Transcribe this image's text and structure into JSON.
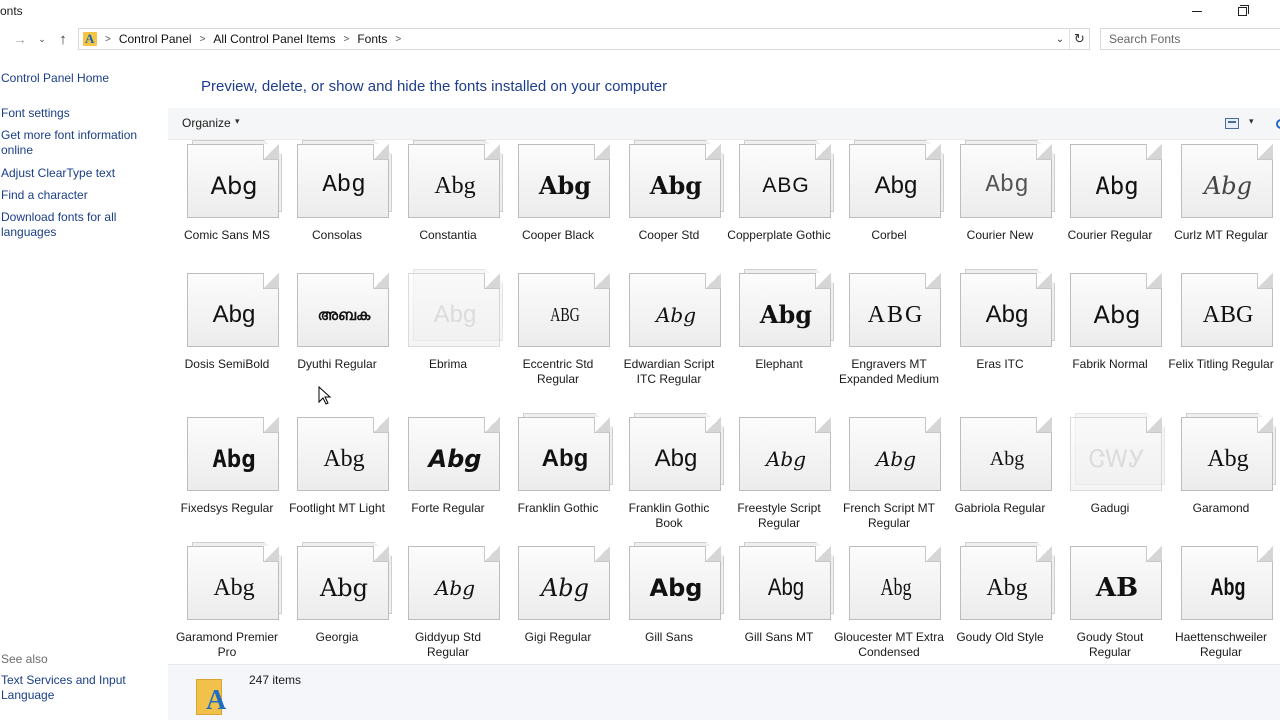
{
  "window": {
    "title": "onts"
  },
  "nav": {
    "back_glyph": "←",
    "forward_glyph": "→",
    "recent_glyph": "⌄",
    "up_glyph": "↑"
  },
  "address": {
    "breadcrumbs": [
      "Control Panel",
      "All Control Panel Items",
      "Fonts"
    ],
    "separator": ">",
    "dropdown_glyph": "⌄",
    "refresh_glyph": "↻"
  },
  "search": {
    "placeholder": "Search Fonts",
    "value": ""
  },
  "sidebar": {
    "links": [
      {
        "label": "Control Panel Home"
      },
      {
        "label": "Font settings"
      },
      {
        "label": "Get more font information online"
      },
      {
        "label": "Adjust ClearType text"
      },
      {
        "label": "Find a character"
      },
      {
        "label": "Download fonts for all languages"
      }
    ],
    "see_also_heading": "See also",
    "see_also_links": [
      {
        "label": "Text Services and Input Language"
      }
    ]
  },
  "main": {
    "heading": "Preview, delete, or show and hide the fonts installed on your computer",
    "toolbar": {
      "organize_label": "Organize",
      "caret": "▾"
    }
  },
  "fonts": [
    {
      "name": "Comic Sans MS",
      "sample": "Abg",
      "stacked": true
    },
    {
      "name": "Consolas",
      "sample": "Abg",
      "stacked": true
    },
    {
      "name": "Constantia",
      "sample": "Abg",
      "stacked": true
    },
    {
      "name": "Cooper Black",
      "sample": "Abg",
      "stacked": false
    },
    {
      "name": "Cooper Std",
      "sample": "Abg",
      "stacked": true
    },
    {
      "name": "Copperplate Gothic",
      "sample": "ABG",
      "stacked": true
    },
    {
      "name": "Corbel",
      "sample": "Abg",
      "stacked": true
    },
    {
      "name": "Courier New",
      "sample": "Abg",
      "stacked": true
    },
    {
      "name": "Courier Regular",
      "sample": "Abg",
      "stacked": false
    },
    {
      "name": "Curlz MT Regular",
      "sample": "Abg",
      "stacked": false
    },
    {
      "name": "Dosis SemiBold",
      "sample": "Abg",
      "stacked": false
    },
    {
      "name": "Dyuthi Regular",
      "sample": "അബക",
      "stacked": false
    },
    {
      "name": "Ebrima",
      "sample": "Abg",
      "stacked": true,
      "faded": true
    },
    {
      "name": "Eccentric Std Regular",
      "sample": "ABG",
      "stacked": false
    },
    {
      "name": "Edwardian Script ITC Regular",
      "sample": "Abg",
      "stacked": false
    },
    {
      "name": "Elephant",
      "sample": "Abg",
      "stacked": true
    },
    {
      "name": "Engravers MT Expanded Medium",
      "sample": "ABG",
      "stacked": false
    },
    {
      "name": "Eras ITC",
      "sample": "Abg",
      "stacked": true
    },
    {
      "name": "Fabrik Normal",
      "sample": "Abg",
      "stacked": false
    },
    {
      "name": "Felix Titling Regular",
      "sample": "ABG",
      "stacked": false
    },
    {
      "name": "Fixedsys Regular",
      "sample": "Abg",
      "stacked": false
    },
    {
      "name": "Footlight MT Light",
      "sample": "Abg",
      "stacked": false
    },
    {
      "name": "Forte Regular",
      "sample": "Abg",
      "stacked": false
    },
    {
      "name": "Franklin Gothic",
      "sample": "Abg",
      "stacked": true
    },
    {
      "name": "Franklin Gothic Book",
      "sample": "Abg",
      "stacked": true
    },
    {
      "name": "Freestyle Script Regular",
      "sample": "Abg",
      "stacked": false
    },
    {
      "name": "French Script MT Regular",
      "sample": "Abg",
      "stacked": false
    },
    {
      "name": "Gabriola Regular",
      "sample": "Abg",
      "stacked": false
    },
    {
      "name": "Gadugi",
      "sample": "ᏣᎳᎩ",
      "stacked": true,
      "faded": true
    },
    {
      "name": "Garamond",
      "sample": "Abg",
      "stacked": true
    },
    {
      "name": "Garamond Premier Pro",
      "sample": "Abg",
      "stacked": true
    },
    {
      "name": "Georgia",
      "sample": "Abg",
      "stacked": true
    },
    {
      "name": "Giddyup Std Regular",
      "sample": "Abg",
      "stacked": false
    },
    {
      "name": "Gigi Regular",
      "sample": "Abg",
      "stacked": false
    },
    {
      "name": "Gill Sans",
      "sample": "Abg",
      "stacked": true
    },
    {
      "name": "Gill Sans MT",
      "sample": "Abg",
      "stacked": true
    },
    {
      "name": "Gloucester MT Extra Condensed",
      "sample": "Abg",
      "stacked": false
    },
    {
      "name": "Goudy Old Style",
      "sample": "Abg",
      "stacked": true
    },
    {
      "name": "Goudy Stout Regular",
      "sample": "AB",
      "stacked": false
    },
    {
      "name": "Haettenschweiler Regular",
      "sample": "Abg",
      "stacked": false
    }
  ],
  "status": {
    "item_count": "247 items"
  }
}
